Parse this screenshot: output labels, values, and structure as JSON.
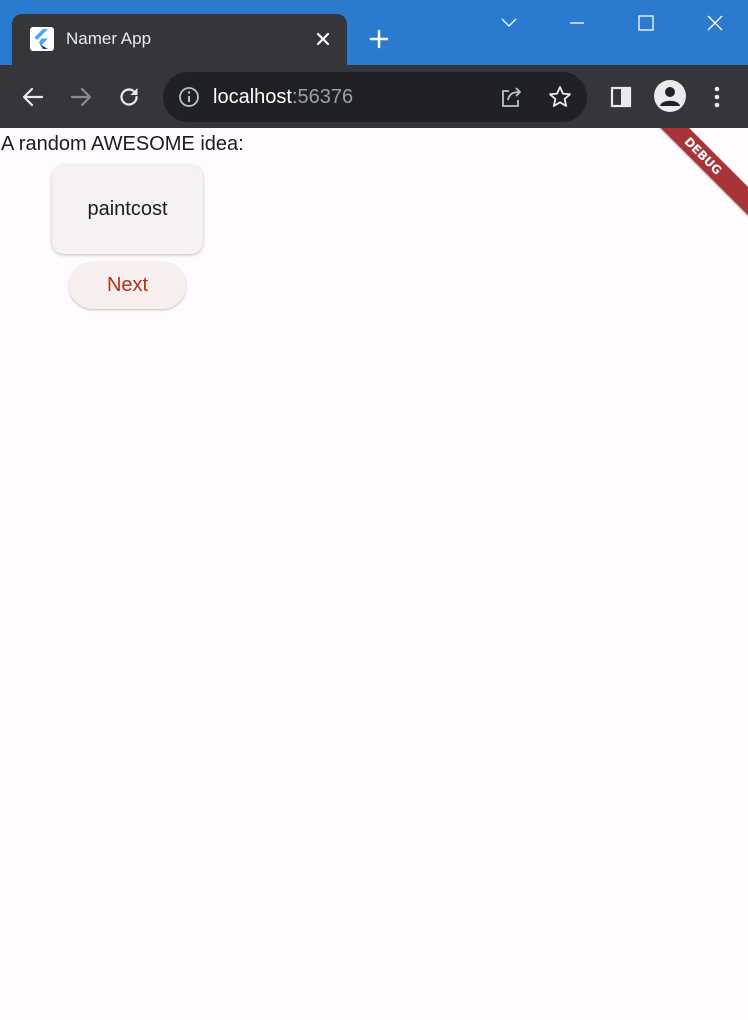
{
  "browser": {
    "tab": {
      "title": "Namer App",
      "favicon": "flutter-logo-icon",
      "close_icon": "close-icon"
    },
    "new_tab_icon": "plus-icon",
    "window_controls": [
      "chevron-down-icon",
      "minimize-icon",
      "maximize-icon",
      "close-icon"
    ],
    "toolbar": {
      "back_icon": "arrow-left-icon",
      "forward_icon": "arrow-right-icon",
      "reload_icon": "reload-icon",
      "address": {
        "host": "localhost",
        "port": ":56376",
        "info_icon": "info-icon",
        "share_icon": "share-icon",
        "bookmark_icon": "star-icon"
      },
      "side_panel_icon": "side-panel-icon",
      "profile_icon": "person-icon",
      "menu_icon": "kebab-menu-icon"
    },
    "colors": {
      "titlebar": "#2a7ad0",
      "toolbar": "#35363a",
      "omnibox": "#202124"
    }
  },
  "app": {
    "heading": "A random AWESOME idea:",
    "word_pair": "paintcost",
    "next_label": "Next",
    "debug_banner": "DEBUG",
    "colors": {
      "background": "#fffbfe",
      "card": "#f7f1f1",
      "button_text": "#b42f14",
      "debug_banner": "#a8343a"
    }
  }
}
